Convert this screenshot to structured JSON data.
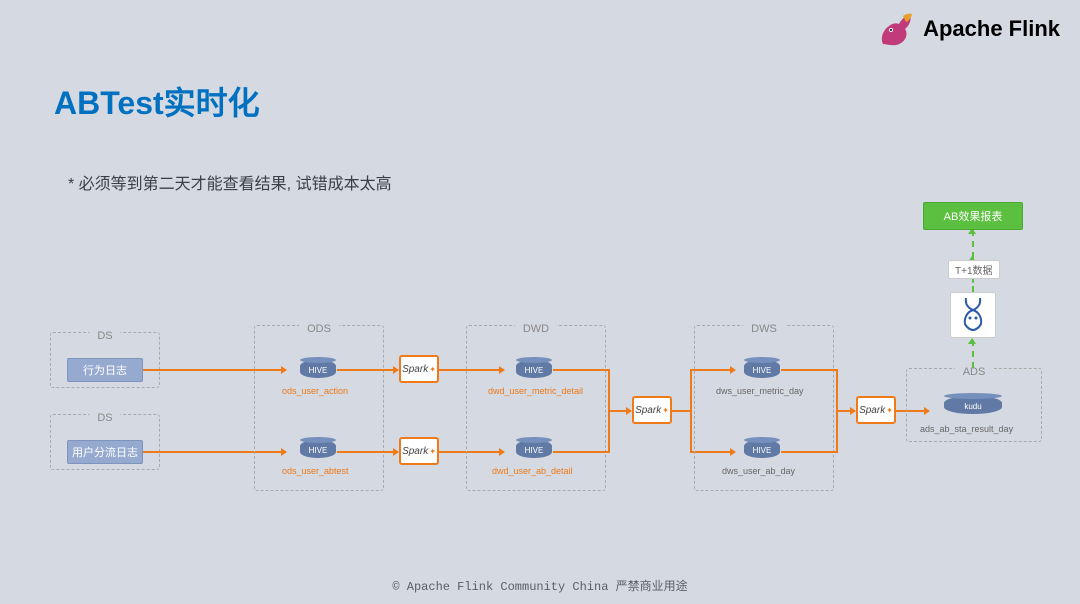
{
  "brand": "Apache Flink",
  "title": "ABTest实时化",
  "bullet": "* 必须等到第二天才能查看结果, 试错成本太高",
  "footer": "© Apache Flink Community China   严禁商业用途",
  "layers": {
    "ds1": {
      "label": "DS",
      "node": "行为日志"
    },
    "ds2": {
      "label": "DS",
      "node": "用户分流日志"
    },
    "ods": {
      "label": "ODS",
      "top": {
        "tech": "HIVE",
        "name": "ods_user_action"
      },
      "bot": {
        "tech": "HIVE",
        "name": "ods_user_abtest"
      }
    },
    "dwd": {
      "label": "DWD",
      "top": {
        "tech": "HIVE",
        "name": "dwd_user_metric_detail"
      },
      "bot": {
        "tech": "HIVE",
        "name": "dwd_user_ab_detail"
      }
    },
    "dws": {
      "label": "DWS",
      "top": {
        "tech": "HIVE",
        "name": "dws_user_metric_day"
      },
      "bot": {
        "tech": "HIVE",
        "name": "dws_user_ab_day"
      }
    },
    "ads": {
      "label": "ADS",
      "node": {
        "tech": "kudu",
        "name": "ads_ab_sta_result_day"
      }
    }
  },
  "spark": "Spark",
  "report": "AB效果报表",
  "t1": "T+1数据"
}
